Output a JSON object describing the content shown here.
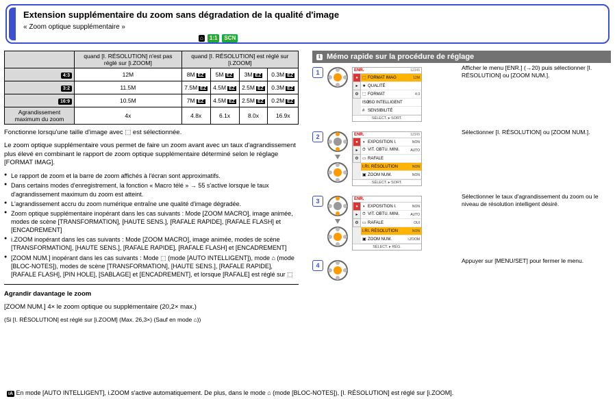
{
  "header": {
    "title": "Extension supplémentaire du zoom sans dégradation de la qualité d'image",
    "subtext": "« Zoom optique supplémentaire »",
    "modes": [
      "⌂",
      "1:1",
      "SCN"
    ]
  },
  "left": {
    "table_head": [
      "",
      "quand [I. RÉSOLUTION] n'est pas réglé sur [i.ZOOM]",
      "",
      "",
      "",
      ""
    ],
    "top_h1": "quand [I. RÉSOLUTION] n'est pas réglé sur [i.ZOOM]",
    "top_h2": "quand [I. RÉSOLUTION] est réglé sur [i.ZOOM]",
    "rows": [
      {
        "ratio": "4:3",
        "c": [
          "12M",
          "8M",
          "5M",
          "3M",
          "0.3M"
        ]
      },
      {
        "ratio": "3:2",
        "c": [
          "11.5M",
          "7.5M",
          "4.5M",
          "2.5M",
          "0.3M"
        ]
      },
      {
        "ratio": "16:9",
        "c": [
          "10.5M",
          "7M",
          "4.5M",
          "2.5M",
          "0.2M"
        ]
      },
      {
        "zoomrow": true,
        "label": "Agrandissement maximum du zoom",
        "c": [
          "4x",
          "4.8x",
          "6.1x",
          "8.0x",
          "16.9x"
        ]
      }
    ],
    "p1": "Fonctionne lorsqu'une taille d'image avec ⬚ est sélectionnée.",
    "p2": "Le zoom optique supplémentaire vous permet de faire un zoom avant avec un taux d'agrandissement plus élevé en combinant le rapport de zoom optique supplémentaire déterminé selon le réglage [FORMAT IMAG].",
    "bullets": [
      "Le rapport de zoom et la barre de zoom affichés à l'écran sont approximatifs.",
      "Dans certains modes d'enregistrement, la fonction « Macro télé » → 55 s'active lorsque le taux d'agrandissement maximum du zoom est atteint.",
      "L'agrandissement accru du zoom numérique entraîne une qualité d'image dégradée.",
      "Zoom optique supplémentaire inopérant dans les cas suivants : Mode [ZOOM MACRO], image animée, modes de scène [TRANSFORMATION], [HAUTE SENS.], [RAFALE RAPIDE], [RAFALE FLASH] et [ENCADREMENT]",
      "i.ZOOM inopérant dans les cas suivants : Mode [ZOOM MACRO], image animée, modes de scène [TRANSFORMATION], [HAUTE SENS.], [RAFALE RAPIDE], [RAFALE FLASH] et [ENCADREMENT]",
      "[ZOOM NUM.] inopérant dans les cas suivants : Mode ⬚ (mode [AUTO INTELLIGENT]), mode ⌂ (mode [BLOC-NOTES]), modes de scène [TRANSFORMATION], [HAUTE SENS.], [RAFALE RAPIDE], [RAFALE FLASH], [PIN HOLE], [SABLAGE] et [ENCADREMENT], et lorsque [RAFALE] est réglé sur ⬚"
    ],
    "section2_title": "Agrandir davantage le zoom",
    "section2_sub": "[ZOOM NUM.] 4× le zoom optique ou supplémentaire (20,2× max.)",
    "section2_note": "(Si [I. RÉSOLUTION] est réglé sur [i.ZOOM] (Max. 26,3×) (Sauf en mode ⌂))"
  },
  "right": {
    "strip_icon": "ℹ",
    "strip_title": "Mémo rapide sur la procédure de réglage",
    "steps": [
      {
        "n": "1",
        "txt": "Afficher le menu [ENR.] (→20) puis sélectionner [I. RÉSOLUTION] ou [ZOOM NUM.].",
        "controls": [
          "center"
        ],
        "menu": {
          "hd": "ENR.",
          "pg": "12345",
          "rows": [
            [
              "⬚",
              "FORMAT IMAG",
              "12M",
              true
            ],
            [
              "★",
              "QUALITÉ",
              "",
              false
            ],
            [
              "⬚",
              "FORMAT",
              "4:3",
              false
            ],
            [
              "ISO",
              "ISO INTELLIGENT",
              "",
              false
            ],
            [
              "#",
              "SENSIBILITÉ",
              "",
              false
            ]
          ],
          "ft": "SÉLECT. ▸ SORT."
        }
      },
      {
        "n": "2",
        "txt": "Sélectionner [I. RÉSOLUTION] ou [ZOOM NUM.].",
        "controls": [
          "vert",
          "center"
        ],
        "menu": {
          "hd": "ENR.",
          "pg": "12345",
          "rows": [
            [
              "◑",
              "EXPOSITION I.",
              "NON",
              false
            ],
            [
              "⏱",
              "VIT. OBTU. MINI.",
              "AUTO",
              false
            ],
            [
              "▭",
              "RAFALE",
              "",
              false
            ],
            [
              "I.R",
              "I. RÉSOLUTION",
              "NON",
              true
            ],
            [
              "▣",
              "ZOOM NUM.",
              "NON",
              false
            ]
          ],
          "ft": "SÉLECT. ▸ SORT."
        }
      },
      {
        "n": "3",
        "txt": "Sélectionner le taux d'agrandissement du zoom ou le niveau de résolution intelligent désiré.",
        "controls": [
          "vert",
          "center"
        ],
        "menu": {
          "hd": "ENR.",
          "pg": "",
          "rows": [
            [
              "◑",
              "EXPOSITION I.",
              "NON",
              false
            ],
            [
              "⏱",
              "VIT. OBTU. MINI.",
              "AUTO",
              false
            ],
            [
              "▭",
              "RAFALE",
              "OUI",
              false
            ],
            [
              "I.R",
              "I. RÉSOLUTION",
              "NON",
              true
            ],
            [
              "▣",
              "ZOOM NUM.",
              "i.ZOOM",
              false
            ]
          ],
          "ft": "SÉLECT. ▸ RÉG."
        }
      },
      {
        "n": "4",
        "txt": "Appuyer sur [MENU/SET] pour fermer le menu.",
        "controls": [
          "center"
        ],
        "menu": null
      }
    ]
  },
  "tip": {
    "prefix_icon": "iA",
    "text": "En mode [AUTO INTELLIGENT], i.ZOOM s'active automatiquement. De plus, dans le mode ⌂ (mode [BLOC-NOTES]), [I. RÉSOLUTION] est réglé sur [i.ZOOM]."
  }
}
